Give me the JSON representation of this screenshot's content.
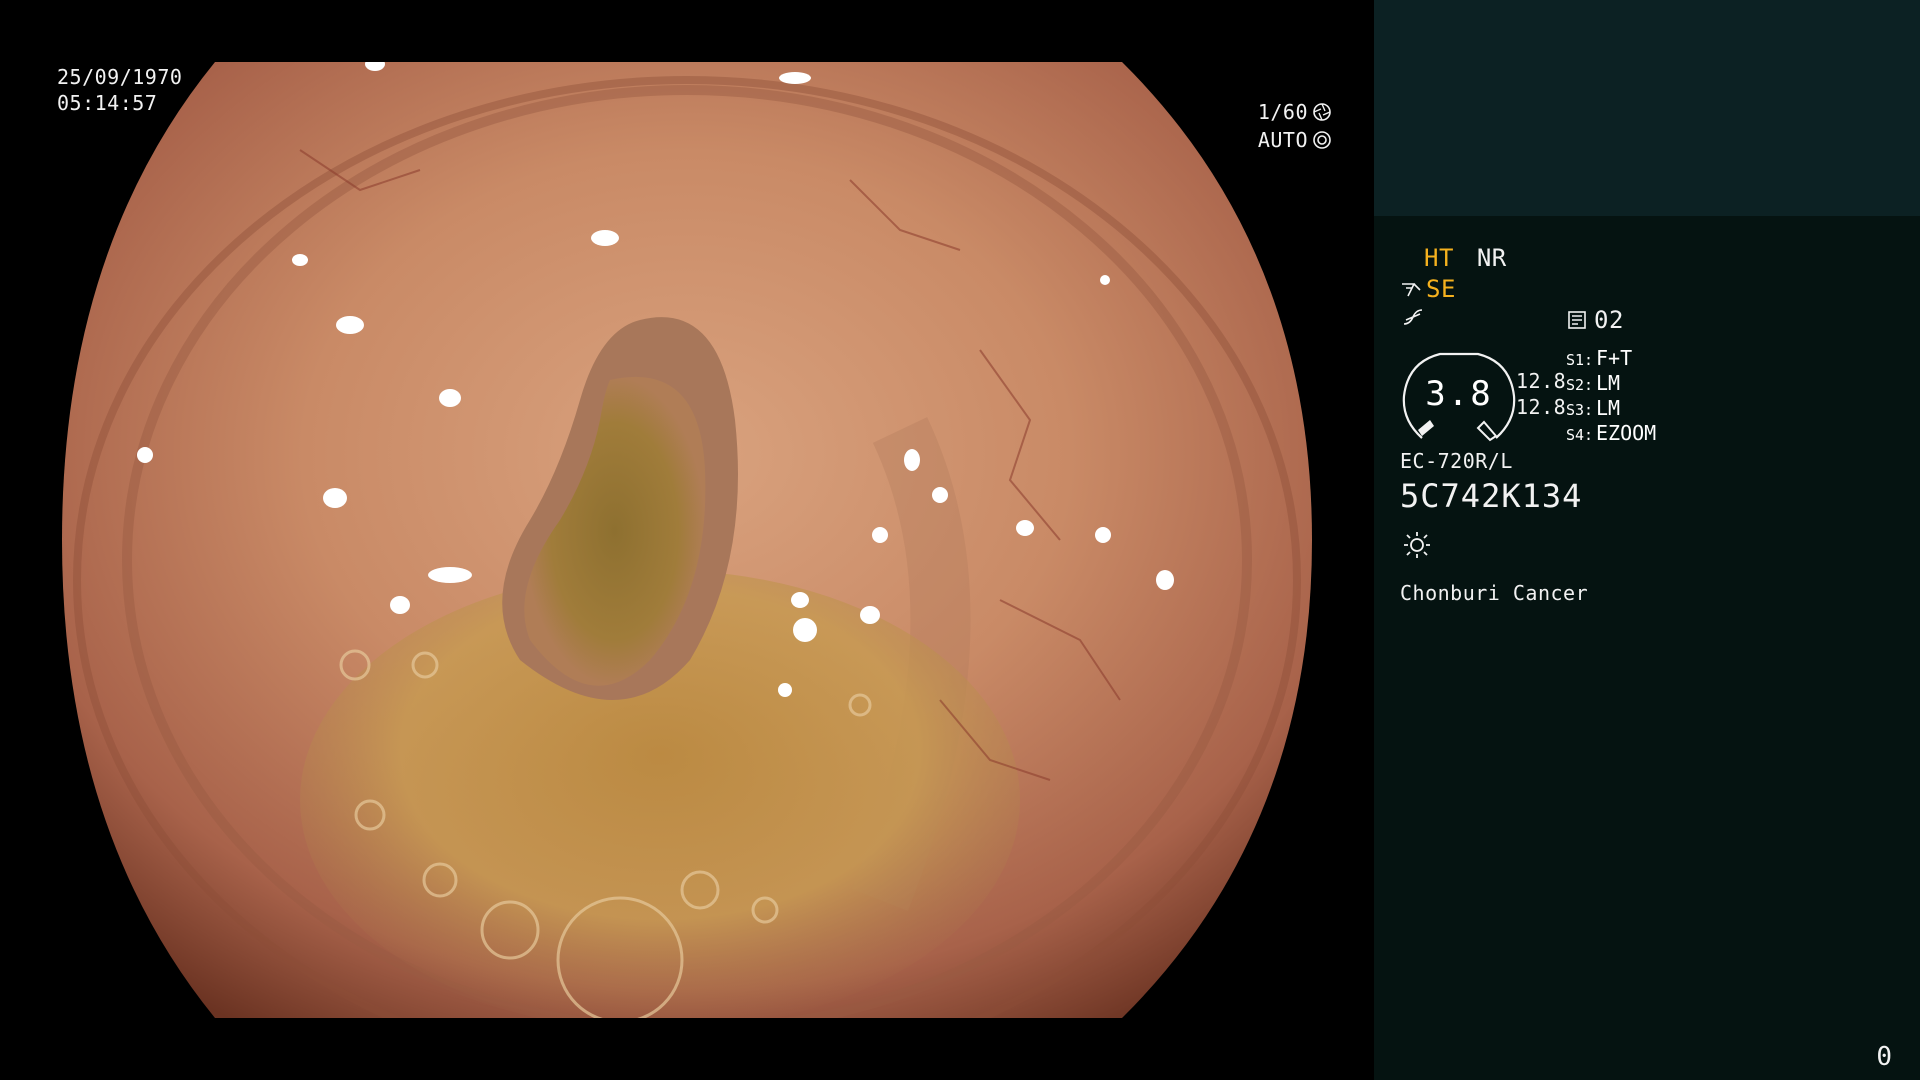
{
  "overlay": {
    "date": "25/09/1970",
    "time": "05:14:57",
    "shutter": "1/60",
    "iris": "AUTO",
    "shutter_icon": "aperture-icon",
    "iris_icon": "iris-icon"
  },
  "panel": {
    "mode_ht": "HT",
    "mode_nr": "NR",
    "enhance": "SE",
    "memo_number": "02",
    "gauge_value": "3.8",
    "gauge_side_top": "12.8",
    "gauge_side_bottom": "12.8",
    "settings": [
      {
        "key": "S1:",
        "value": "F+T"
      },
      {
        "key": "S2:",
        "value": "LM"
      },
      {
        "key": "S3:",
        "value": "LM"
      },
      {
        "key": "S4:",
        "value": "EZOOM"
      }
    ],
    "scope_model": "EC-720R/L",
    "scope_serial": "5C742K134",
    "institution": "Chonburi Cancer",
    "counter": "0",
    "accent_color": "#f5b11e",
    "panel_bg": "#051311",
    "panel_top_bg": "#0c2123"
  }
}
